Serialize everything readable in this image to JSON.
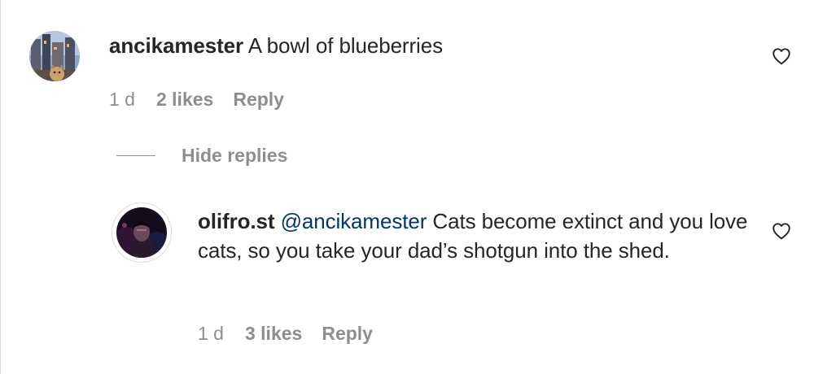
{
  "comment": {
    "username": "ancikamester",
    "text": " A bowl of blueberries",
    "time": "1 d",
    "likes": "2 likes",
    "reply_label": "Reply",
    "avatar_icon": "city-street-avatar"
  },
  "replies_toggle": {
    "label": "Hide replies"
  },
  "reply": {
    "username": "olifro.st",
    "mention": "@ancikamester",
    "text": " Cats become extinct and you love cats, so you take your dad’s shotgun into the shed.",
    "time": "1 d",
    "likes": "3 likes",
    "reply_label": "Reply",
    "avatar_icon": "dark-portrait-avatar"
  },
  "icons": {
    "like": "heart-outline-icon"
  },
  "colors": {
    "text": "#262626",
    "secondary": "#8e8e8e",
    "mention": "#00376b"
  }
}
